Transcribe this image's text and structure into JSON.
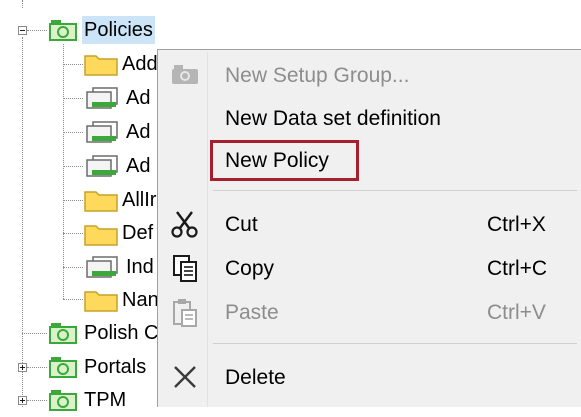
{
  "tree": {
    "items": [
      {
        "label": "Policies",
        "expander": "minus",
        "selected": true
      },
      {
        "label": "Add",
        "icon": "folder-icon"
      },
      {
        "label": "Ad",
        "icon": "dataset-icon"
      },
      {
        "label": "Ad",
        "icon": "dataset-icon"
      },
      {
        "label": "Ad",
        "icon": "dataset-icon"
      },
      {
        "label": "AllIr",
        "icon": "folder-icon"
      },
      {
        "label": "Def",
        "icon": "folder-icon"
      },
      {
        "label": "Ind",
        "icon": "dataset-icon"
      },
      {
        "label": "Nan",
        "icon": "folder-icon"
      },
      {
        "label": "Polish C",
        "icon": "policy-group-icon"
      },
      {
        "label": "Portals",
        "expander": "plus",
        "icon": "policy-group-icon"
      },
      {
        "label": "TPM",
        "expander": "plus",
        "icon": "policy-group-icon"
      }
    ]
  },
  "context_menu": {
    "items": [
      {
        "label": "New Setup Group...",
        "shortcut": "",
        "disabled": true,
        "icon": "camera-group-icon"
      },
      {
        "label": "New Data set definition",
        "shortcut": "",
        "disabled": false,
        "icon": ""
      },
      {
        "label": "New Policy",
        "shortcut": "",
        "disabled": false,
        "icon": "",
        "highlighted": true
      },
      {
        "label": "Cut",
        "shortcut": "Ctrl+X",
        "disabled": false,
        "icon": "scissors-icon"
      },
      {
        "label": "Copy",
        "shortcut": "Ctrl+C",
        "disabled": false,
        "icon": "copy-icon"
      },
      {
        "label": "Paste",
        "shortcut": "Ctrl+V",
        "disabled": true,
        "icon": "paste-icon"
      },
      {
        "label": "Delete",
        "shortcut": "",
        "disabled": false,
        "icon": "delete-x-icon"
      }
    ]
  },
  "colors": {
    "selection": "#cce4f7",
    "highlight_border": "#a61f2e",
    "menu_background": "#f0f0f0",
    "disabled_text": "#8d8d8d",
    "folder": "#ffd95c",
    "policy_group": "#3ca83c"
  }
}
